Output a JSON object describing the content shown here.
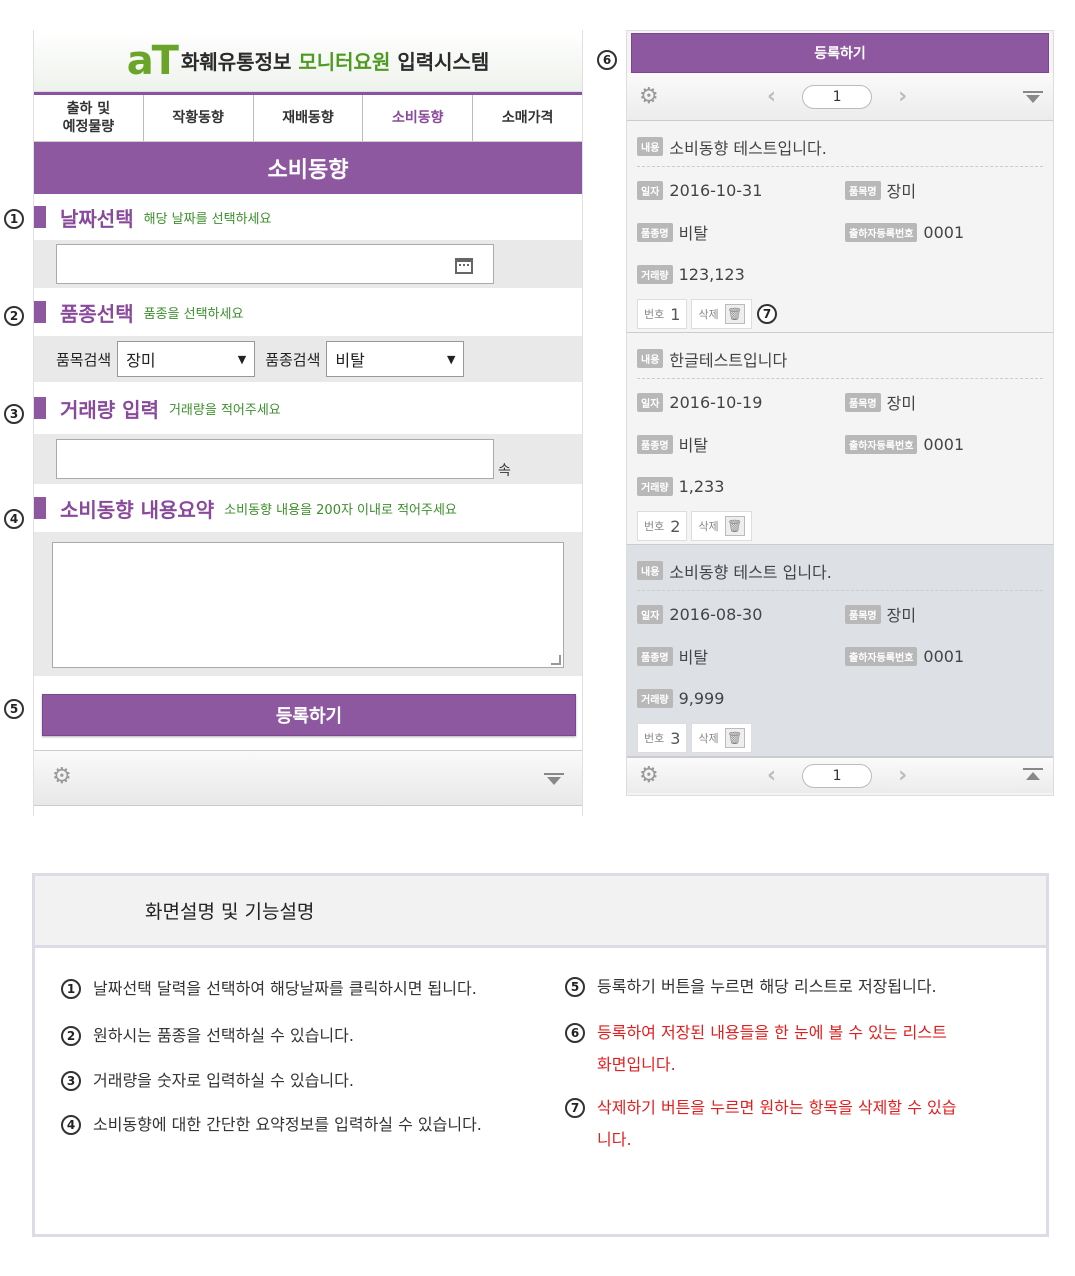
{
  "left": {
    "logo": "aT",
    "title_black": "화훼유통정보",
    "title_green": "모니터요원",
    "title_black2": "입력시스템",
    "tabs": [
      "출하 및\n예정물량",
      "작황동향",
      "재배동향",
      "소비동향",
      "소매가격"
    ],
    "active_tab": 3,
    "section_title": "소비동향",
    "date": {
      "label": "날짜선택",
      "hint": "해당 날짜를 선택하세요",
      "value": ""
    },
    "variety": {
      "label": "품종선택",
      "hint": "품종을 선택하세요",
      "item_search_label": "품목검색",
      "item_value": "장미",
      "variety_search_label": "품종검색",
      "variety_value": "비탈"
    },
    "qty": {
      "label": "거래량 입력",
      "hint": "거래량을 적어주세요",
      "unit": "속",
      "value": ""
    },
    "summary": {
      "label": "소비동향 내용요약",
      "hint": "소비동향 내용을 200자 이내로 적어주세요",
      "value": ""
    },
    "register_label": "등록하기"
  },
  "right": {
    "register_label": "등록하기",
    "page": "1",
    "tag_labels": {
      "content": "내용",
      "date": "일자",
      "item": "품목명",
      "variety": "품종명",
      "shipper": "출하자등록번호",
      "qty": "거래량"
    },
    "num_label": "번호",
    "delete_label": "삭제",
    "items": [
      {
        "content": "소비동향 테스트입니다.",
        "date": "2016-10-31",
        "item": "장미",
        "variety": "비탈",
        "shipper": "0001",
        "qty": "123,123",
        "no": "1"
      },
      {
        "content": "한글테스트입니다",
        "date": "2016-10-19",
        "item": "장미",
        "variety": "비탈",
        "shipper": "0001",
        "qty": "1,233",
        "no": "2"
      },
      {
        "content": "소비동향 테스트 입니다.",
        "date": "2016-08-30",
        "item": "장미",
        "variety": "비탈",
        "shipper": "0001",
        "qty": "9,999",
        "no": "3"
      }
    ]
  },
  "markers": [
    "1",
    "2",
    "3",
    "4",
    "5",
    "6",
    "7"
  ],
  "description": {
    "heading": "화면설명 및 기능설명",
    "items": [
      {
        "n": "1",
        "text": "날짜선택 달력을 선택하여 해당날짜를 클릭하시면 됩니다."
      },
      {
        "n": "2",
        "text": "원하시는 품종을 선택하실 수 있습니다."
      },
      {
        "n": "3",
        "text": "거래량을 숫자로 입력하실 수 있습니다."
      },
      {
        "n": "4",
        "text": "소비동향에 대한 간단한 요약정보를 입력하실 수 있습니다."
      },
      {
        "n": "5",
        "text": "등록하기 버튼을 누르면 해당 리스트로 저장됩니다."
      },
      {
        "n": "6",
        "text": "등록하여 저장된 내용들을 한 눈에 볼 수 있는 리스트 화면입니다."
      },
      {
        "n": "7",
        "text": "삭제하기 버튼을 누르면 원하는 항목을 삭제할 수 있습니다."
      }
    ]
  }
}
